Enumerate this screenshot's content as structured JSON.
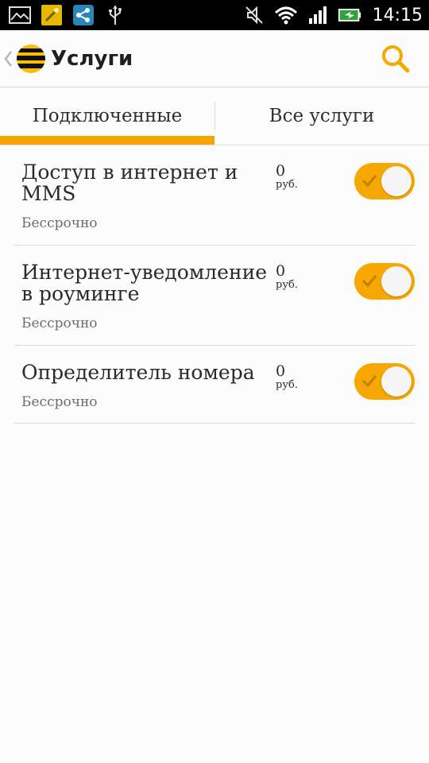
{
  "status_bar": {
    "time": "14:15",
    "left_icons": [
      "gallery-icon",
      "app-notification-icon",
      "share-icon",
      "usb-icon"
    ],
    "right_icons": [
      "mute-icon",
      "wifi-icon",
      "signal-icon",
      "battery-charging-icon"
    ]
  },
  "header": {
    "title": "Услуги"
  },
  "tabs": [
    {
      "label": "Подключенные",
      "active": true
    },
    {
      "label": "Все услуги",
      "active": false
    }
  ],
  "services": [
    {
      "name": "Доступ в интернет и MMS",
      "term": "Бессрочно",
      "price": "0",
      "unit": "руб.",
      "enabled": true
    },
    {
      "name": "Интернет-уведомление в роуминге",
      "term": "Бессрочно",
      "price": "0",
      "unit": "руб.",
      "enabled": true
    },
    {
      "name": "Определитель номера",
      "term": "Бессрочно",
      "price": "0",
      "unit": "руб.",
      "enabled": true
    }
  ],
  "colors": {
    "accent": "#f6a800",
    "status_bar": "#000000"
  }
}
